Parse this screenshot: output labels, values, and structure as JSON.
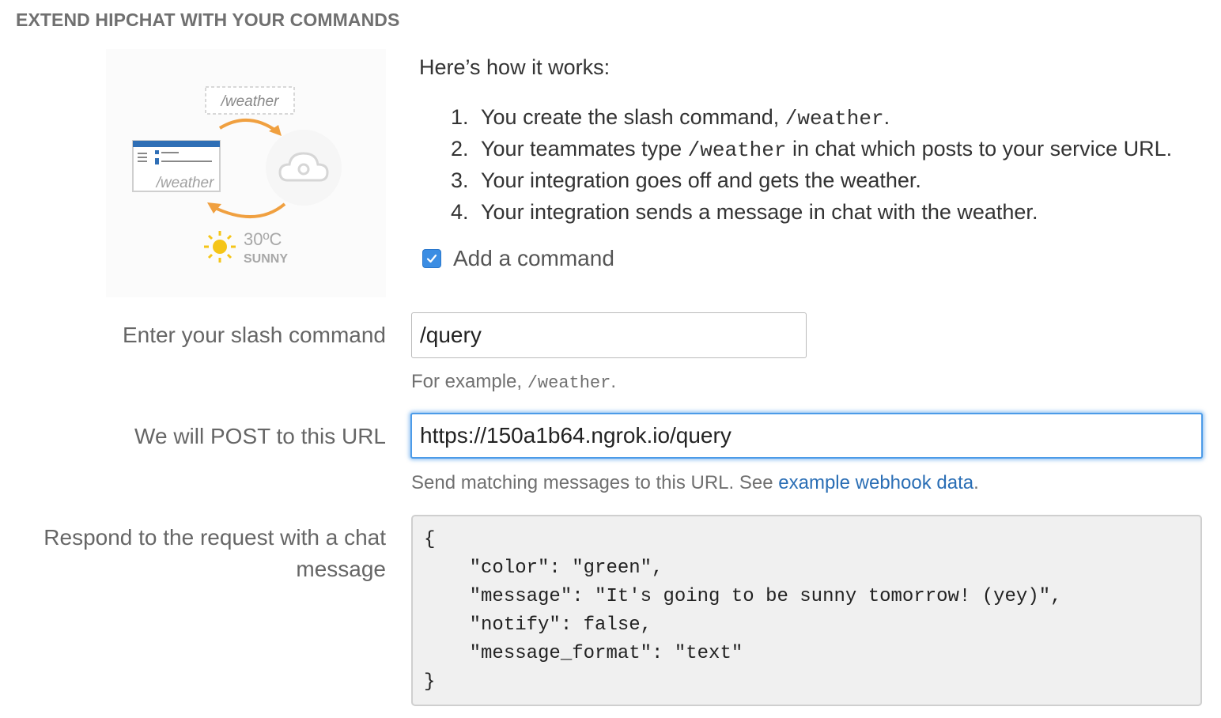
{
  "section": {
    "title": "EXTEND HIPCHAT WITH YOUR COMMANDS"
  },
  "illustration": {
    "command_tag": "/weather",
    "window_text": "/weather",
    "temperature": "30ºC",
    "condition": "SUNNY"
  },
  "how": {
    "heading": "Here’s how it works:",
    "steps": [
      {
        "num": "1.",
        "before": "You create the slash command, ",
        "code": "/weather",
        "after": "."
      },
      {
        "num": "2.",
        "before": "Your teammates type ",
        "code": "/weather",
        "after": " in chat which posts to your service URL."
      },
      {
        "num": "3.",
        "before": "Your integration goes off and gets the weather.",
        "code": "",
        "after": ""
      },
      {
        "num": "4.",
        "before": "Your integration sends a message in chat with the weather.",
        "code": "",
        "after": ""
      }
    ]
  },
  "add_command": {
    "label": "Add a command",
    "checked": true
  },
  "slash": {
    "label": "Enter your slash command",
    "value": "/query",
    "help_before": "For example, ",
    "help_code": "/weather",
    "help_after": "."
  },
  "url": {
    "label": "We will POST to this URL",
    "value": "https://150a1b64.ngrok.io/query",
    "help_before": "Send matching messages to this URL. See ",
    "help_link": "example webhook data",
    "help_after": "."
  },
  "response": {
    "label_line1": "Respond to the request with a chat",
    "label_line2": "message",
    "code": "{\n    \"color\": \"green\",\n    \"message\": \"It's going to be sunny tomorrow! (yey)\",\n    \"notify\": false,\n    \"message_format\": \"text\"\n}"
  },
  "colors": {
    "accent": "#3b8de3",
    "link": "#2a6eb5",
    "arrow": "#f0a040",
    "sun": "#f5c518"
  },
  "icons": [
    "cloud-gear-icon",
    "sun-icon",
    "checkmark-icon",
    "cycle-arrow-icon"
  ]
}
